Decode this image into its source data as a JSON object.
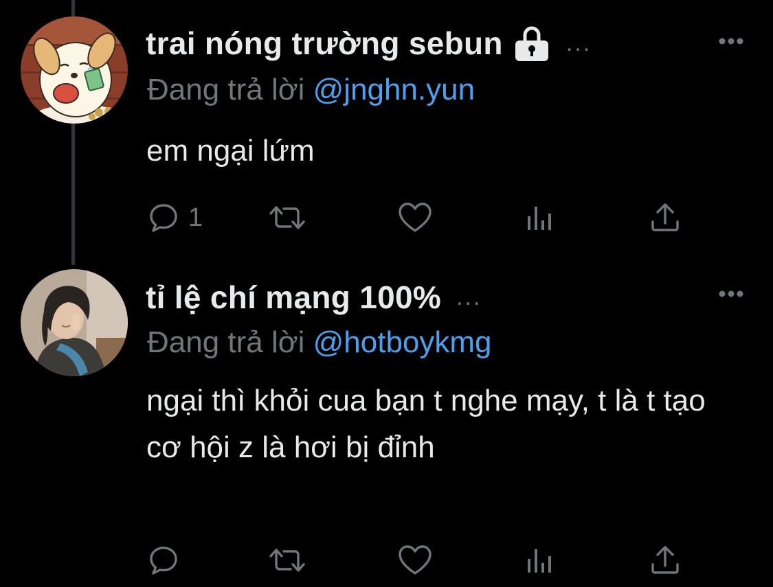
{
  "tweets": [
    {
      "name": "trai nóng trường sebun",
      "name_suffix": "...",
      "replying_prefix": "Đang trả lời",
      "replying_handle": "@jnghn.yun",
      "text": "em ngại lứm",
      "reply_count": "1",
      "locked": true
    },
    {
      "name": "tỉ lệ chí mạng 100%",
      "name_suffix": "...",
      "replying_prefix": "Đang trả lời",
      "replying_handle": "@hotboykmg",
      "text": "ngại thì khỏi cua bạn t nghe mạy, t là t tạo cơ hội z là hơi bị đỉnh",
      "reply_count": "",
      "locked": false
    }
  ],
  "icons": {
    "lock": "lock-icon",
    "more": "more-icon",
    "reply": "reply-icon",
    "retweet": "retweet-icon",
    "like": "like-icon",
    "views": "views-icon",
    "share": "share-icon"
  },
  "colors": {
    "background": "#000000",
    "text": "#e7e9ea",
    "secondary": "#71767b",
    "link": "#4ba1f0",
    "thread_line": "#333639"
  }
}
